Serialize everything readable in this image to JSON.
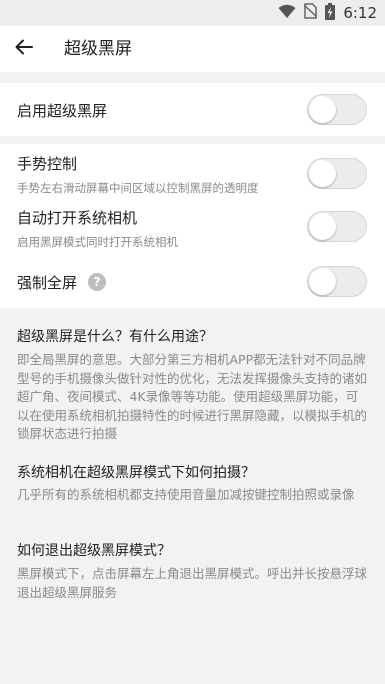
{
  "status_bar": {
    "time": "6:12",
    "icons": [
      "wifi-icon",
      "no-sim-icon",
      "battery-charging-icon"
    ]
  },
  "app_bar": {
    "back_icon": "arrow-back-icon",
    "title": "超级黑屏"
  },
  "settings": {
    "enable": {
      "label": "启用超级黑屏",
      "on": false
    },
    "gesture": {
      "label": "手势控制",
      "description": "手势左右滑动屏幕中间区域以控制黑屏的透明度",
      "on": false
    },
    "auto_camera": {
      "label": "自动打开系统相机",
      "description": "启用黑屏模式同时打开系统相机",
      "on": false
    },
    "fullscreen": {
      "label": "强制全屏",
      "help_glyph": "?",
      "on": false
    }
  },
  "faq": [
    {
      "question": "超级黑屏是什么？有什么用途？",
      "answer": "即全局黑屏的意思。大部分第三方相机APP都无法针对不同品牌型号的手机摄像头做针对性的优化，无法发挥摄像头支持的诸如超广角、夜间模式、4K录像等等功能。使用超级黑屏功能，可以在使用系统相机拍摄特性的时候进行黑屏隐藏，以模拟手机的锁屏状态进行拍摄"
    },
    {
      "question": "系统相机在超级黑屏模式下如何拍摄？",
      "answer": "几乎所有的系统相机都支持使用音量加减按键控制拍照或录像"
    },
    {
      "question": "如何退出超级黑屏模式？",
      "answer": "黑屏模式下，点击屏幕左上角退出黑屏模式。呼出并长按悬浮球退出超级黑屏服务"
    }
  ]
}
